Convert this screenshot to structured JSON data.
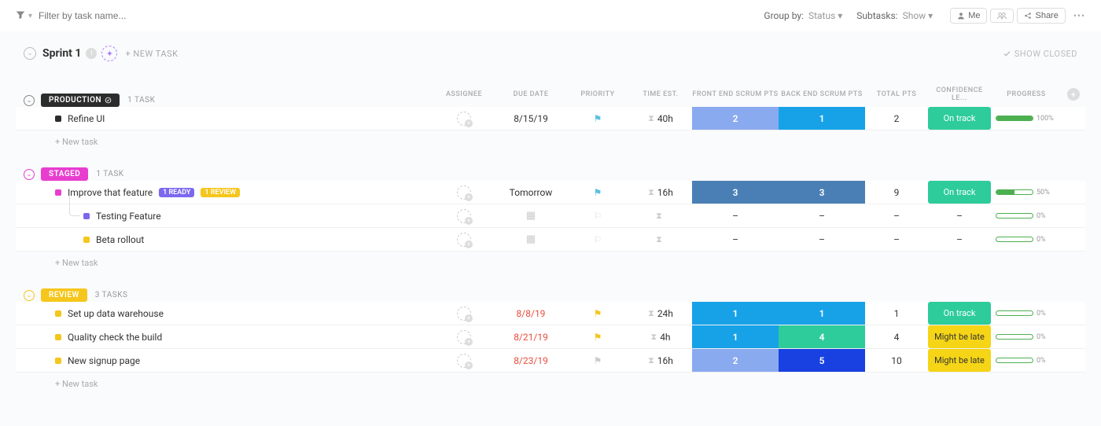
{
  "toolbar": {
    "filter_placeholder": "Filter by task name...",
    "group_by_label": "Group by:",
    "group_by_value": "Status",
    "subtasks_label": "Subtasks:",
    "subtasks_value": "Show",
    "me_label": "Me",
    "share_label": "Share"
  },
  "sprint": {
    "title": "Sprint 1",
    "new_task_label": "+ NEW TASK",
    "show_closed_label": "SHOW CLOSED"
  },
  "columns": {
    "assignee": "ASSIGNEE",
    "due_date": "DUE DATE",
    "priority": "PRIORITY",
    "time_est": "TIME EST.",
    "front_end": "FRONT END SCRUM PTS",
    "back_end": "BACK END SCRUM PTS",
    "total_pts": "TOTAL PTS",
    "confidence": "CONFIDENCE LE...",
    "progress": "PROGRESS"
  },
  "groups": {
    "production": {
      "label": "PRODUCTION",
      "color": "#2c2c2c",
      "border": "#888",
      "task_count": "1 TASK",
      "new_task": "+ New task",
      "tasks": [
        {
          "name": "Refine UI",
          "dot": "#2c2c2c",
          "due": "8/15/19",
          "due_red": false,
          "flag": "#5bc0de",
          "time": "40h",
          "fe": "2",
          "fe_color": "#8aaaf0",
          "be": "1",
          "be_color": "#17a2e8",
          "total": "2",
          "conf": "On track",
          "conf_color": "#2ecc9a",
          "progress": 100,
          "progress_label": "100%"
        }
      ]
    },
    "staged": {
      "label": "STAGED",
      "color": "#e83ecf",
      "border": "#e83ecf",
      "task_count": "1 TASK",
      "new_task": "+ New task",
      "tasks": [
        {
          "name": "Improve that feature",
          "dot": "#e83ecf",
          "tags": [
            {
              "label": "1 READY",
              "color": "#7b68ee"
            },
            {
              "label": "1 REVIEW",
              "color": "#f5c61c"
            }
          ],
          "due": "Tomorrow",
          "due_red": false,
          "flag": "#5bc0de",
          "time": "16h",
          "fe": "3",
          "fe_color": "#4a7fb5",
          "be": "3",
          "be_color": "#4a7fb5",
          "total": "9",
          "conf": "On track",
          "conf_color": "#2ecc9a",
          "progress": 50,
          "progress_label": "50%",
          "subtasks": [
            {
              "name": "Testing Feature",
              "dot": "#7b68ee",
              "progress": 0,
              "progress_label": "0%"
            },
            {
              "name": "Beta rollout",
              "dot": "#f5c61c",
              "progress": 0,
              "progress_label": "0%"
            }
          ]
        }
      ]
    },
    "review": {
      "label": "REVIEW",
      "color": "#f5c61c",
      "border": "#f5c61c",
      "task_count": "3 TASKS",
      "new_task": "+ New task",
      "tasks": [
        {
          "name": "Set up data warehouse",
          "dot": "#f5c61c",
          "due": "8/8/19",
          "due_red": true,
          "flag": "#f5c61c",
          "time": "24h",
          "fe": "1",
          "fe_color": "#17a2e8",
          "be": "1",
          "be_color": "#17a2e8",
          "total": "1",
          "conf": "On track",
          "conf_color": "#2ecc9a",
          "progress": 0,
          "progress_label": "0%"
        },
        {
          "name": "Quality check the build",
          "dot": "#f5c61c",
          "due": "8/21/19",
          "due_red": true,
          "flag": "#f5c61c",
          "time": "4h",
          "fe": "1",
          "fe_color": "#17a2e8",
          "be": "4",
          "be_color": "#2ecc9a",
          "total": "4",
          "conf": "Might be late",
          "conf_color": "#f5d516",
          "conf_text": "#333",
          "progress": 0,
          "progress_label": "0%"
        },
        {
          "name": "New signup page",
          "dot": "#f5c61c",
          "due": "8/23/19",
          "due_red": true,
          "flag": "#ccc",
          "time": "16h",
          "fe": "2",
          "fe_color": "#8aaaf0",
          "be": "5",
          "be_color": "#1940e0",
          "total": "10",
          "conf": "Might be late",
          "conf_color": "#f5d516",
          "conf_text": "#333",
          "progress": 0,
          "progress_label": "0%"
        }
      ]
    }
  }
}
